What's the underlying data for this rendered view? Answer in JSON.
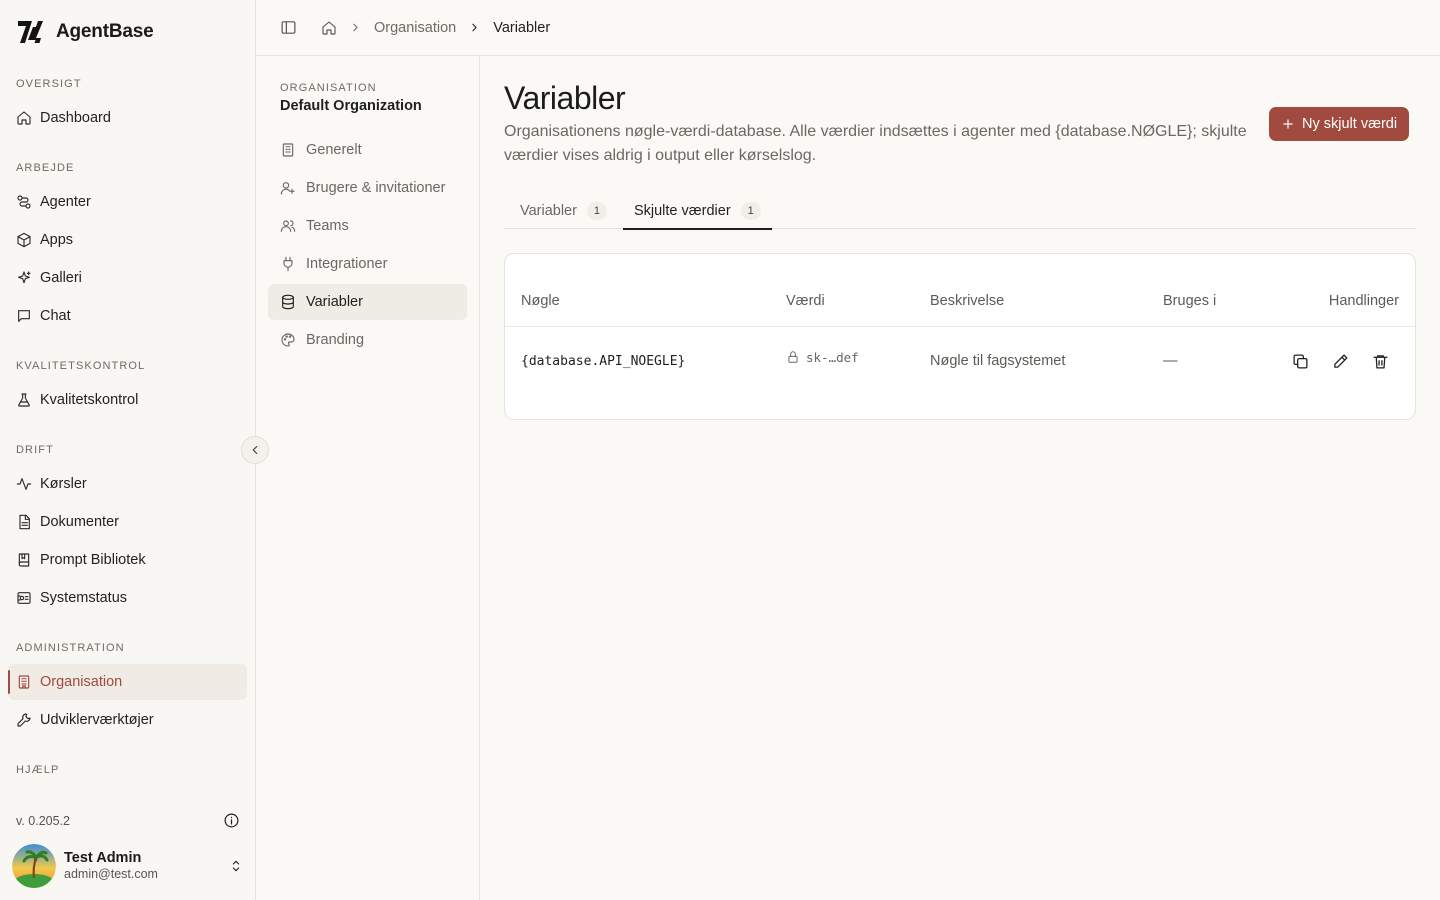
{
  "app": {
    "name": "AgentBase"
  },
  "sidebar": {
    "sections": [
      {
        "title": "OVERSIGT",
        "items": [
          {
            "label": "Dashboard",
            "icon": "home-icon"
          }
        ]
      },
      {
        "title": "ARBEJDE",
        "items": [
          {
            "label": "Agenter",
            "icon": "route-icon"
          },
          {
            "label": "Apps",
            "icon": "box-icon"
          },
          {
            "label": "Galleri",
            "icon": "sparkle-icon"
          },
          {
            "label": "Chat",
            "icon": "message-icon"
          }
        ]
      },
      {
        "title": "KVALITETSKONTROL",
        "items": [
          {
            "label": "Kvalitetskontrol",
            "icon": "flask-icon"
          }
        ]
      },
      {
        "title": "DRIFT",
        "items": [
          {
            "label": "Kørsler",
            "icon": "activity-icon"
          },
          {
            "label": "Dokumenter",
            "icon": "document-icon"
          },
          {
            "label": "Prompt Bibliotek",
            "icon": "book-icon"
          },
          {
            "label": "Systemstatus",
            "icon": "server-icon"
          }
        ]
      },
      {
        "title": "ADMINISTRATION",
        "items": [
          {
            "label": "Organisation",
            "icon": "building-icon",
            "active": true
          },
          {
            "label": "Udviklerværktøjer",
            "icon": "wrench-icon"
          }
        ]
      },
      {
        "title": "HJÆLP",
        "items": []
      }
    ],
    "version": "v. 0.205.2",
    "user": {
      "name": "Test Admin",
      "email": "admin@test.com"
    }
  },
  "breadcrumb": {
    "items": [
      "Organisation",
      "Variabler"
    ]
  },
  "settings_nav": {
    "org_label": "ORGANISATION",
    "org_name": "Default Organization",
    "items": [
      {
        "label": "Generelt",
        "icon": "building-icon"
      },
      {
        "label": "Brugere & invitationer",
        "icon": "user-plus-icon"
      },
      {
        "label": "Teams",
        "icon": "users-icon"
      },
      {
        "label": "Integrationer",
        "icon": "plug-icon"
      },
      {
        "label": "Variabler",
        "icon": "database-icon",
        "active": true
      },
      {
        "label": "Branding",
        "icon": "palette-icon"
      }
    ]
  },
  "page": {
    "title": "Variabler",
    "description": "Organisationens nøgle-værdi-database. Alle værdier indsættes i agenter med {database.NØGLE}; skjulte værdier vises aldrig i output eller kørselslog.",
    "new_button": "Ny skjult værdi",
    "tabs": [
      {
        "label": "Variabler",
        "count": "1"
      },
      {
        "label": "Skjulte værdier",
        "count": "1",
        "active": true
      }
    ],
    "table": {
      "columns": [
        "Nøgle",
        "Værdi",
        "Beskrivelse",
        "Bruges i",
        "Handlinger"
      ],
      "rows": [
        {
          "key": "{database.API_NOEGLE}",
          "value": "sk-…def",
          "description": "Nøgle til fagsystemet",
          "used_in": "—"
        }
      ]
    }
  },
  "colors": {
    "accent": "#a14a40",
    "background": "#fbf9f6",
    "sidebar": "#f9f7f3"
  }
}
